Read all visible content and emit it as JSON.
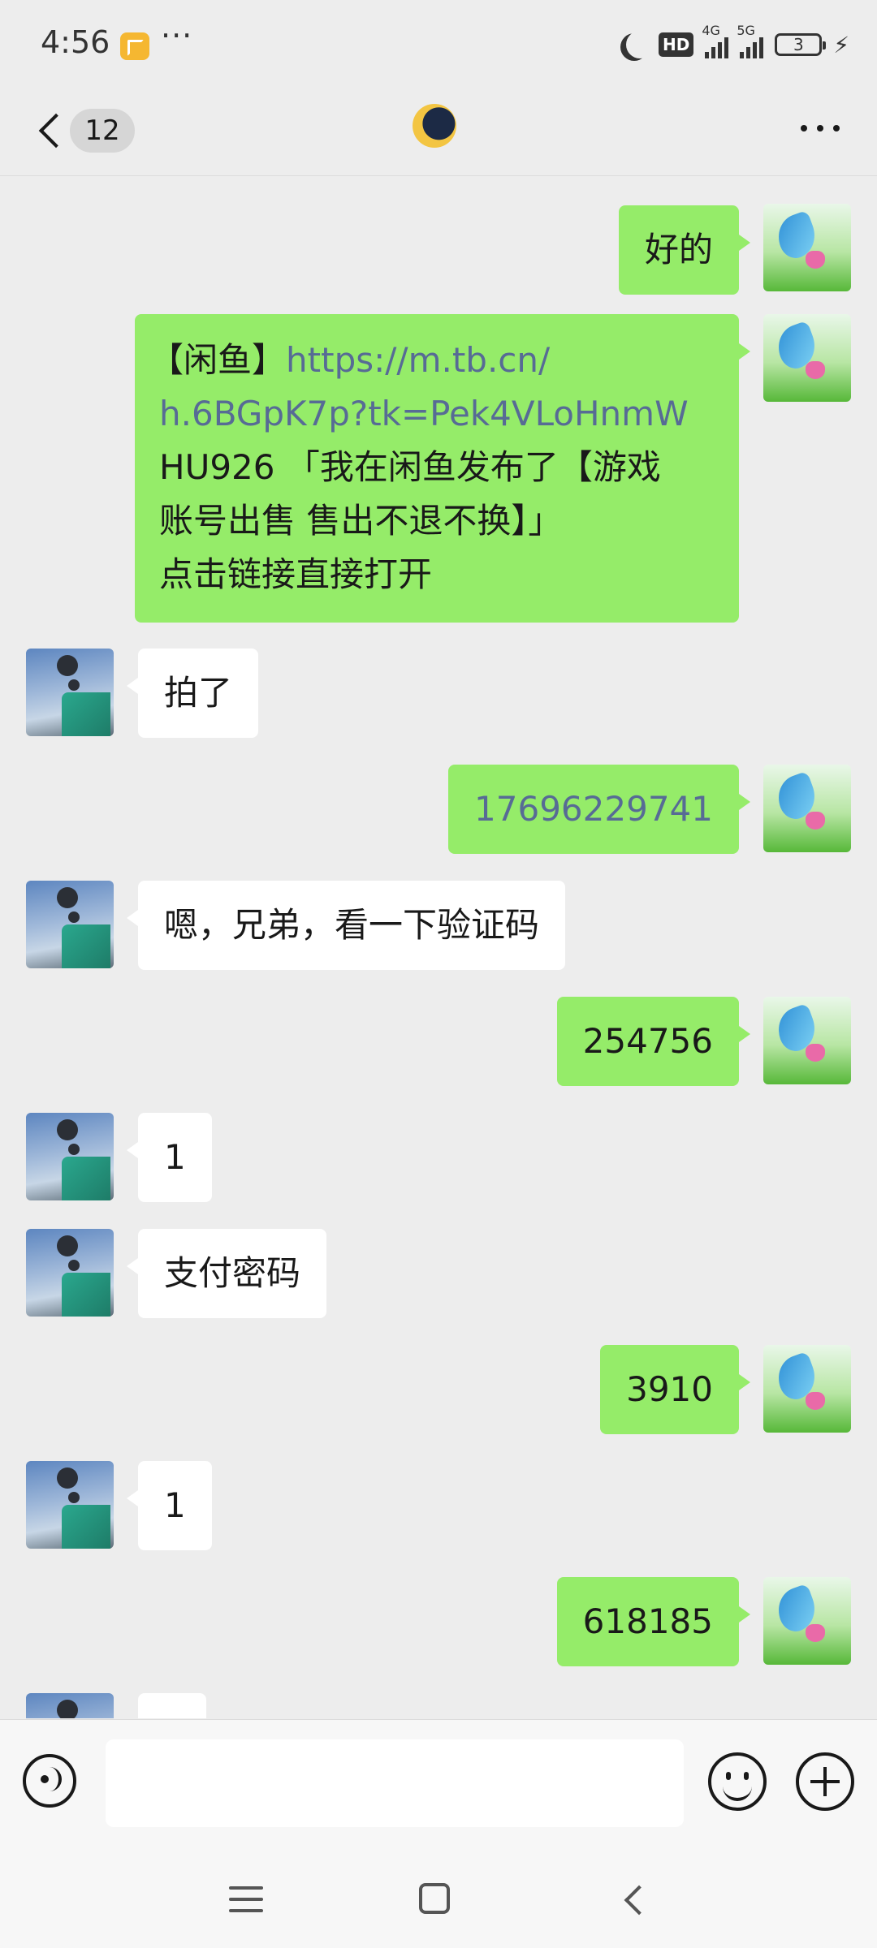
{
  "status_bar": {
    "time": "4:56",
    "more": "···",
    "hd_label": "HD",
    "net1": "4G",
    "net2": "5G",
    "battery": "3",
    "charging_icon": "⚡"
  },
  "header": {
    "unread_count": "12"
  },
  "messages": [
    {
      "from": "me",
      "text": "好的"
    },
    {
      "from": "me",
      "lines": [
        {
          "prefix": "【闲鱼】",
          "link": "https://m.tb.cn/"
        },
        {
          "link": "h.6BGpK7p?tk=Pek4VLoHnmW"
        },
        {
          "text": "HU926 「我在闲鱼发布了【游戏"
        },
        {
          "text": "账号出售 售出不退不换】」"
        },
        {
          "text": "点击链接直接打开"
        }
      ]
    },
    {
      "from": "other",
      "text": "拍了"
    },
    {
      "from": "me",
      "text": "17696229741"
    },
    {
      "from": "other",
      "text": "嗯，兄弟，看一下验证码"
    },
    {
      "from": "me",
      "text": "254756"
    },
    {
      "from": "other",
      "text": "1"
    },
    {
      "from": "other",
      "text": "支付密码"
    },
    {
      "from": "me",
      "text": "3910"
    },
    {
      "from": "other",
      "text": "1"
    },
    {
      "from": "me",
      "text": "618185"
    }
  ],
  "input": {
    "placeholder": "",
    "value": ""
  },
  "colors": {
    "my_bubble": "#95ec69",
    "other_bubble": "#ffffff",
    "link": "#576b95",
    "background": "#ededed"
  }
}
